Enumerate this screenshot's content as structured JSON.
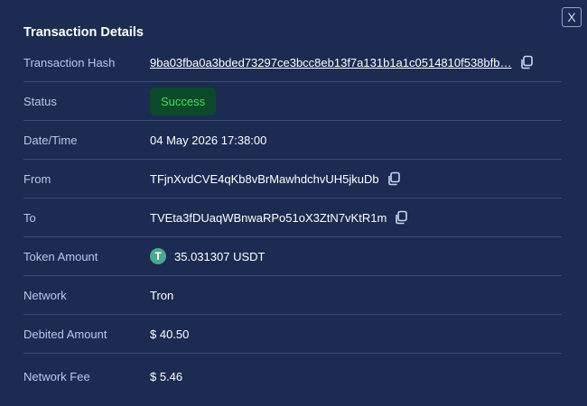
{
  "dialog": {
    "title": "Transaction Details",
    "close_label": "X"
  },
  "rows": {
    "hash": {
      "label": "Transaction Hash",
      "value": "9ba03fba0a3bded73297ce3bcc8eb13f7a131b1a1c0514810f538bfb…"
    },
    "status": {
      "label": "Status",
      "value": "Success"
    },
    "datetime": {
      "label": "Date/Time",
      "value": "04 May 2026 17:38:00"
    },
    "from": {
      "label": "From",
      "value": "TFjnXvdCVE4qKb8vBrMawhdchvUH5jkuDb"
    },
    "to": {
      "label": "To",
      "value": "TVEta3fDUaqWBnwaRPo51oX3ZtN7vKtR1m"
    },
    "token_amount": {
      "label": "Token Amount",
      "value": "35.031307 USDT",
      "icon": "tether-icon",
      "icon_glyph": "T"
    },
    "network": {
      "label": "Network",
      "value": "Tron"
    },
    "debited_amount": {
      "label": "Debited Amount",
      "value": "$ 40.50"
    },
    "network_fee": {
      "label": "Network Fee",
      "value": "$ 5.46"
    }
  },
  "colors": {
    "background": "#1b2b51",
    "label": "#b9c8ea",
    "success_text": "#4cdb5e",
    "success_bg": "#0a4a2a",
    "tether": "#4aa88f",
    "divider": "#3c4d73"
  }
}
